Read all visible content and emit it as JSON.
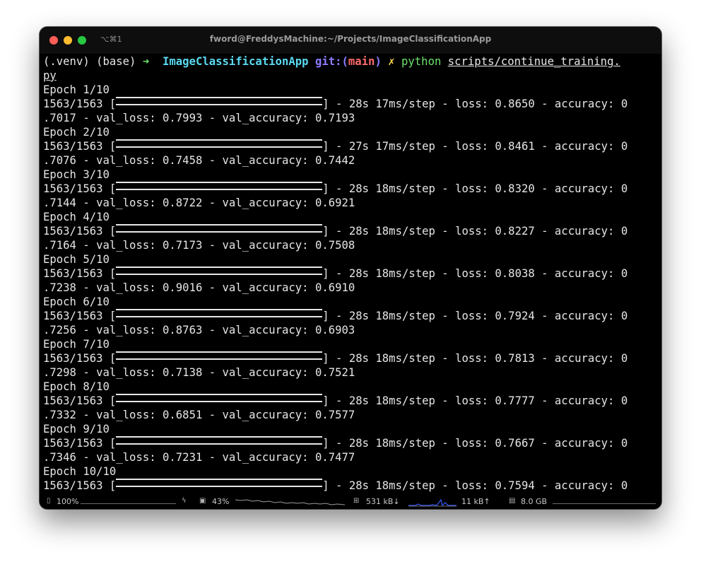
{
  "window": {
    "shortcut": "⌥⌘1",
    "title": "fword@FreddysMachine:~/Projects/ImageClassificationApp"
  },
  "prompt": {
    "venv": "(.venv) (base)",
    "arrow": "➜",
    "directory": "ImageClassificationApp",
    "git_label": "git:(",
    "branch": "main",
    "git_close": ")",
    "dirty_mark": "✗",
    "command": "python",
    "argument_line1": "scripts/continue_training.",
    "argument_line2": "py"
  },
  "training": {
    "step_counter": "1563/1563",
    "epochs": [
      {
        "label": "Epoch 1/10",
        "time": "28s",
        "step": "17ms/step",
        "loss": "0.8650",
        "acc_head": "0",
        "acc_tail": ".7017",
        "val_loss": "0.7993",
        "val_accuracy": "0.7193"
      },
      {
        "label": "Epoch 2/10",
        "time": "27s",
        "step": "17ms/step",
        "loss": "0.8461",
        "acc_head": "0",
        "acc_tail": ".7076",
        "val_loss": "0.7458",
        "val_accuracy": "0.7442"
      },
      {
        "label": "Epoch 3/10",
        "time": "28s",
        "step": "18ms/step",
        "loss": "0.8320",
        "acc_head": "0",
        "acc_tail": ".7144",
        "val_loss": "0.8722",
        "val_accuracy": "0.6921"
      },
      {
        "label": "Epoch 4/10",
        "time": "28s",
        "step": "18ms/step",
        "loss": "0.8227",
        "acc_head": "0",
        "acc_tail": ".7164",
        "val_loss": "0.7173",
        "val_accuracy": "0.7508"
      },
      {
        "label": "Epoch 5/10",
        "time": "28s",
        "step": "18ms/step",
        "loss": "0.8038",
        "acc_head": "0",
        "acc_tail": ".7238",
        "val_loss": "0.9016",
        "val_accuracy": "0.6910"
      },
      {
        "label": "Epoch 6/10",
        "time": "28s",
        "step": "18ms/step",
        "loss": "0.7924",
        "acc_head": "0",
        "acc_tail": ".7256",
        "val_loss": "0.8763",
        "val_accuracy": "0.6903"
      },
      {
        "label": "Epoch 7/10",
        "time": "28s",
        "step": "18ms/step",
        "loss": "0.7813",
        "acc_head": "0",
        "acc_tail": ".7298",
        "val_loss": "0.7138",
        "val_accuracy": "0.7521"
      },
      {
        "label": "Epoch 8/10",
        "time": "28s",
        "step": "18ms/step",
        "loss": "0.7777",
        "acc_head": "0",
        "acc_tail": ".7332",
        "val_loss": "0.6851",
        "val_accuracy": "0.7577"
      },
      {
        "label": "Epoch 9/10",
        "time": "28s",
        "step": "18ms/step",
        "loss": "0.7667",
        "acc_head": "0",
        "acc_tail": ".7346",
        "val_loss": "0.7231",
        "val_accuracy": "0.7477"
      },
      {
        "label": "Epoch 10/10",
        "time": "28s",
        "step": "18ms/step",
        "loss": "0.7594",
        "acc_head": "0",
        "acc_tail": "",
        "val_loss": "",
        "val_accuracy": ""
      }
    ]
  },
  "statusbar": {
    "battery_icon": "battery-icon",
    "battery": "100%",
    "battery_level": 1.0,
    "power_icon": "lightning-icon",
    "cpu_icon": "cpu-icon",
    "cpu": "43%",
    "network_icon": "network-icon",
    "download": "531 kB↓",
    "upload": "11 kB↑",
    "memory_icon": "memory-icon",
    "memory": "8.0 GB",
    "colors": {
      "download_graph": "#3b5bff",
      "cpu_graph": "#9a9a9a"
    }
  }
}
